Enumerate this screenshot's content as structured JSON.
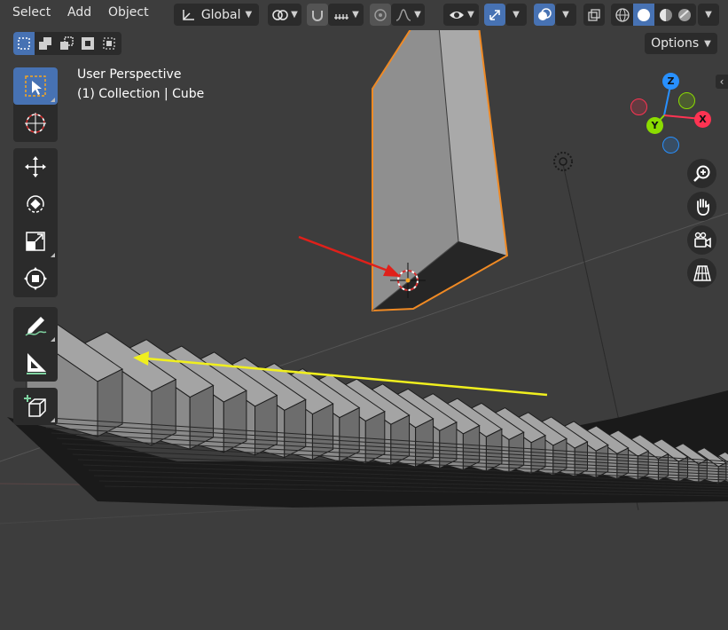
{
  "header": {
    "menus": [
      "Select",
      "Add",
      "Object"
    ],
    "transform_orientation": "Global",
    "options_label": "Options"
  },
  "viewport": {
    "view_name": "User Perspective",
    "collection_info": "(1) Collection | Cube"
  },
  "gizmo": {
    "axes": [
      "Z",
      "Y",
      "X"
    ],
    "colors": {
      "x": "#ff3352",
      "y": "#8bdc00",
      "z": "#2890ff"
    }
  },
  "tools": [
    "select-box",
    "cursor",
    "move",
    "rotate",
    "scale",
    "transform",
    "annotate",
    "measure",
    "add-cube"
  ],
  "nav_buttons": [
    "zoom",
    "pan",
    "camera",
    "orthographic"
  ],
  "annotations": {
    "red_arrow_color": "#e0201a",
    "yellow_arrow_color": "#f0ef1e",
    "selection_outline": "#f08a24"
  }
}
